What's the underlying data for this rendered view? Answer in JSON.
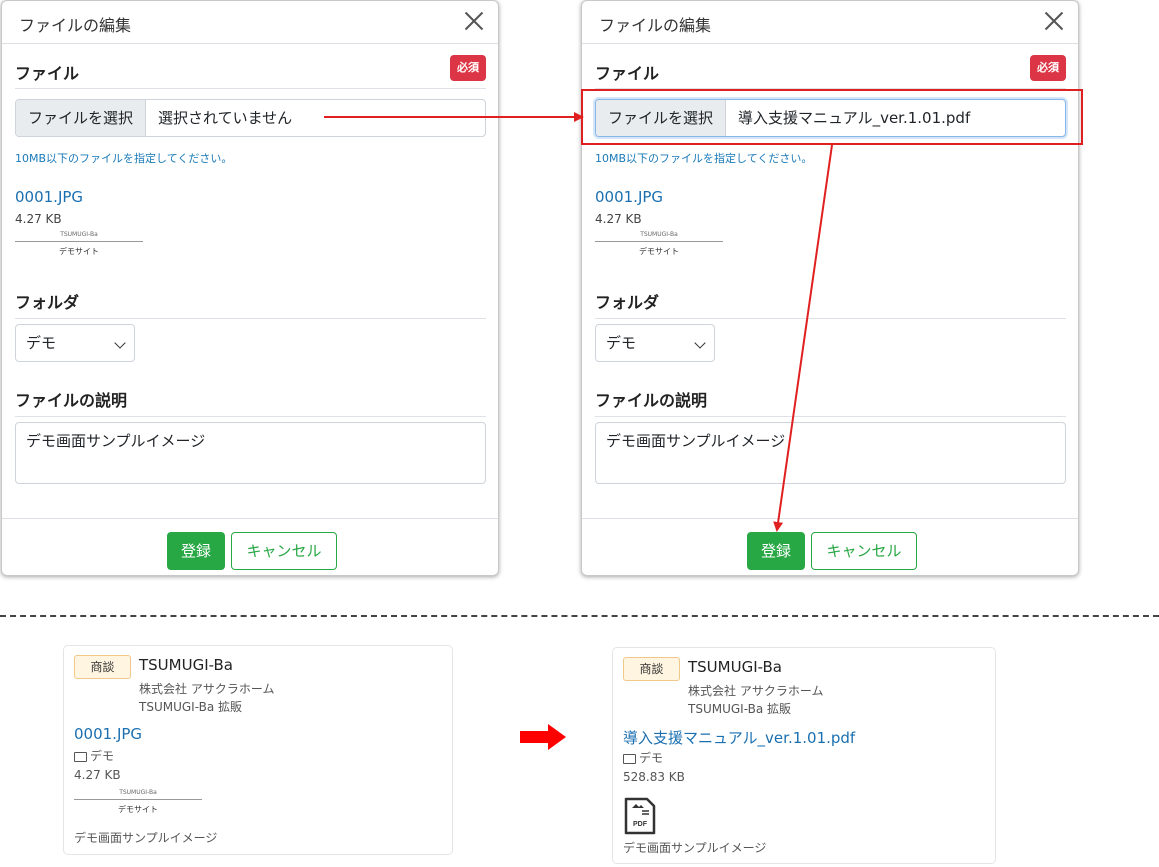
{
  "modal_left": {
    "title": "ファイルの編集",
    "file_section_label": "ファイル",
    "required_badge": "必須",
    "select_button": "ファイルを選択",
    "file_value": "選択されていません",
    "hint": "10MB以下のファイルを指定してください。",
    "current_file": "0001.JPG",
    "current_size": "4.27 KB",
    "thumb_logo": "TSUMUGI-Ba",
    "thumb_site": "デモサイト",
    "folder_label": "フォルダ",
    "folder_value": "デモ",
    "desc_label": "ファイルの説明",
    "desc_value": "デモ画面サンプルイメージ",
    "ok_button": "登録",
    "cancel_button": "キャンセル"
  },
  "modal_right": {
    "title": "ファイルの編集",
    "file_section_label": "ファイル",
    "required_badge": "必須",
    "select_button": "ファイルを選択",
    "file_value": "導入支援マニュアル_ver.1.01.pdf",
    "hint": "10MB以下のファイルを指定してください。",
    "current_file": "0001.JPG",
    "current_size": "4.27 KB",
    "thumb_logo": "TSUMUGI-Ba",
    "thumb_site": "デモサイト",
    "folder_label": "フォルダ",
    "folder_value": "デモ",
    "desc_label": "ファイルの説明",
    "desc_value": "デモ画面サンプルイメージ",
    "ok_button": "登録",
    "cancel_button": "キャンセル"
  },
  "card_before": {
    "badge": "商談",
    "company": "TSUMUGI-Ba",
    "customer": "株式会社 アサクラホーム",
    "project": "TSUMUGI-Ba 拡販",
    "file_name": "0001.JPG",
    "folder": "デモ",
    "size": "4.27 KB",
    "thumb_logo": "TSUMUGI-Ba",
    "thumb_site": "デモサイト",
    "description": "デモ画面サンプルイメージ"
  },
  "card_after": {
    "badge": "商談",
    "company": "TSUMUGI-Ba",
    "customer": "株式会社 アサクラホーム",
    "project": "TSUMUGI-Ba 拡販",
    "file_name": "導入支援マニュアル_ver.1.01.pdf",
    "folder": "デモ",
    "size": "528.83 KB",
    "pdf_label": "PDF",
    "description": "デモ画面サンプルイメージ"
  },
  "colors": {
    "accent_red": "#e02020",
    "success_green": "#28a745",
    "danger": "#dc3545",
    "link_blue": "#1a6fb0"
  }
}
